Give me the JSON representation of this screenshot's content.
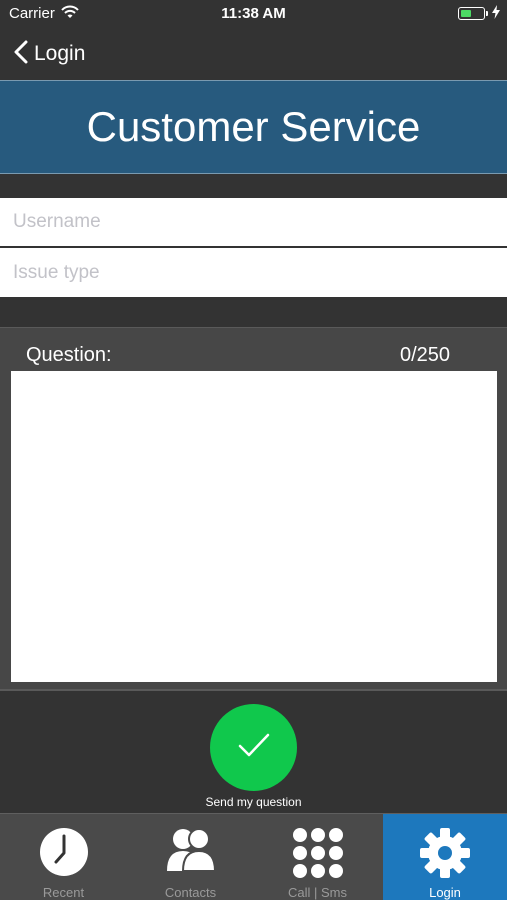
{
  "status_bar": {
    "carrier": "Carrier",
    "time": "11:38 AM",
    "battery_level": 0.45
  },
  "nav": {
    "back_label": "Login"
  },
  "header": {
    "title": "Customer Service"
  },
  "form": {
    "username_placeholder": "Username",
    "username_value": "",
    "issue_placeholder": "Issue type",
    "issue_value": "",
    "question_label": "Question:",
    "question_counter": "0/250",
    "question_value": ""
  },
  "send": {
    "label": "Send my question"
  },
  "tabs": [
    {
      "label": "Recent",
      "icon": "clock-icon",
      "active": false
    },
    {
      "label": "Contacts",
      "icon": "contacts-icon",
      "active": false
    },
    {
      "label": "Call | Sms",
      "icon": "keypad-icon",
      "active": false
    },
    {
      "label": "Login",
      "icon": "gear-icon",
      "active": true
    }
  ],
  "colors": {
    "header_bg": "#275a7e",
    "send_button": "#10c84c",
    "active_tab": "#1d78bd",
    "battery_fill": "#4cd964"
  }
}
